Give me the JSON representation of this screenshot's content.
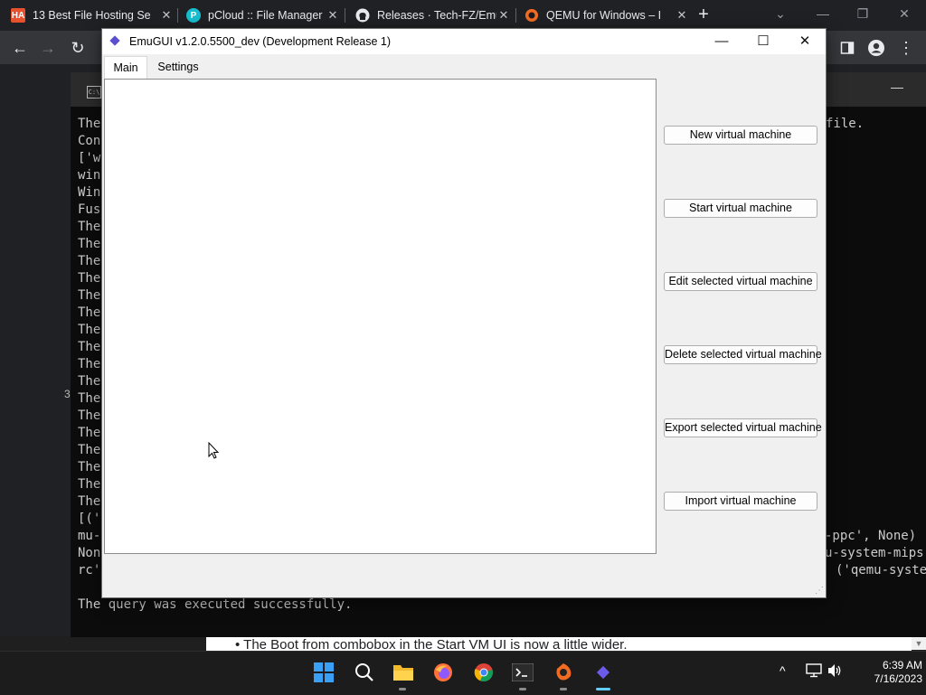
{
  "browser": {
    "tabs": [
      {
        "label": "13 Best File Hosting Se",
        "icon": "HA"
      },
      {
        "label": "pCloud :: File Manager",
        "icon": "P"
      },
      {
        "label": "Releases · Tech-FZ/Emu",
        "icon": "github-icon"
      },
      {
        "label": "QEMU for Windows – I",
        "icon": "qemu-icon"
      }
    ],
    "new_tab": "+",
    "controls": {
      "minimize": "—",
      "restore": "❐",
      "close": "✕",
      "tab_search": "⌄"
    }
  },
  "toolbar": {
    "back": "←",
    "forward": "→",
    "reload": "↻",
    "menu": "⋮"
  },
  "terminal": {
    "lines": [
      "The",
      "Con",
      "['w",
      "win",
      "Win",
      "Fus",
      "The",
      "The",
      "The",
      "The",
      "The",
      "The",
      "The",
      "The",
      "The",
      "The",
      "The",
      "The",
      "The",
      "The",
      "The",
      "The",
      "The",
      "[('",
      "mu-",
      "Non",
      "rc'",
      "The query was executed successfully."
    ],
    "right_fragments": [
      "file.",
      "-ppc', None)",
      "u-system-mips",
      "('qemu-syste"
    ],
    "left_fragment": "3"
  },
  "webpage": {
    "bullet": "The Boot from combobox in the Start VM UI is now a little wider."
  },
  "emugui": {
    "title": "EmuGUI v1.2.0.5500_dev (Development Release 1)",
    "tabs": [
      "Main",
      "Settings"
    ],
    "buttons": [
      "New virtual machine",
      "Start virtual machine",
      "Edit selected virtual machine",
      "Delete selected virtual machine",
      "Export selected virtual machine",
      "Import virtual machine"
    ],
    "caption": {
      "minimize": "—",
      "maximize": "☐",
      "close": "✕"
    }
  },
  "taskbar": {
    "apps": [
      "start",
      "search",
      "file-explorer",
      "firefox",
      "chrome",
      "terminal",
      "qemu",
      "emugui"
    ],
    "tray": {
      "chevron": "^",
      "network": "🖥",
      "volume": "🔊"
    },
    "time": "6:39 AM",
    "date": "7/16/2023"
  }
}
